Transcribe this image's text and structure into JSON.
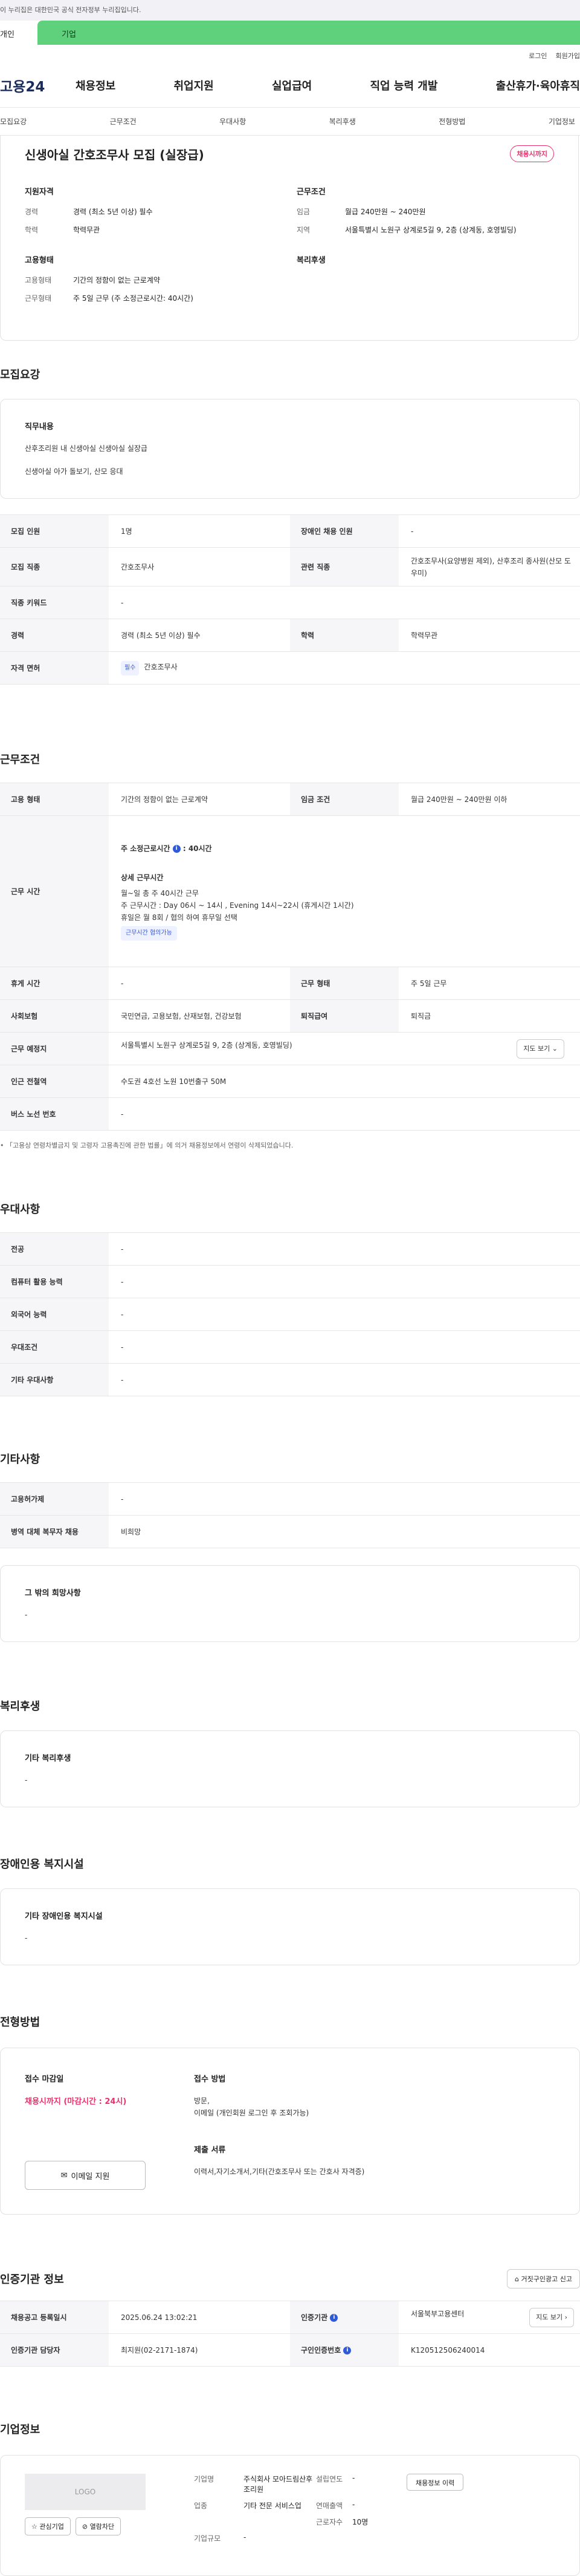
{
  "gov_bar": {
    "text": "이 누리집은 대한민국 공식 전자정부 누리집입니다."
  },
  "tabs": {
    "person": "개인",
    "company": "기업"
  },
  "util": {
    "login": "로그인",
    "signup": "회원가입"
  },
  "gnb": {
    "logo": "고용24",
    "items": [
      "채용정보",
      "취업지원",
      "실업급여",
      "직업 능력 개발",
      "출산휴가·육아휴직"
    ]
  },
  "anchor_nav": [
    "모집요강",
    "근무조건",
    "우대사항",
    "복리후생",
    "전형방법",
    "기업정보"
  ],
  "summary": {
    "title": "신생아실 간호조무사 모집 (실장급)",
    "badge": "채용시까지",
    "qual_heading": "지원자격",
    "qual_rows": [
      {
        "k": "경력",
        "v": "경력 (최소 5년 이상) 필수"
      },
      {
        "k": "학력",
        "v": "학력무관"
      }
    ],
    "cond_heading": "근무조건",
    "cond_rows": [
      {
        "k": "임금",
        "v": "월급 240만원 ~ 240만원"
      },
      {
        "k": "지역",
        "v": "서울특별시 노원구 상계로5길 9, 2층 (상계동, 호영빌딩)"
      }
    ],
    "emp_heading": "고용형태",
    "emp_rows": [
      {
        "k": "고용형태",
        "v": "기간의 정함이 없는 근로계약"
      },
      {
        "k": "근무형태",
        "v": "주 5일 근무 (주 소정근로시간: 40시간)"
      }
    ],
    "welfare_heading": "복리후생"
  },
  "recruit": {
    "heading": "모집요강",
    "duty_heading": "직무내용",
    "duty_lines": [
      "산후조리원 내 신생아실 신생아실 실장급",
      "신생아실 아가 돌보기, 산모 응대"
    ],
    "rows": [
      [
        "모집 인원",
        "1명",
        "장애인 채용 인원",
        "-"
      ],
      [
        "모집 직종",
        "간호조무사",
        "관련 직종",
        "간호조무사(요양병원 제외), 산후조리 종사원(산모 도우미)"
      ],
      [
        "직종 키워드",
        "-"
      ],
      [
        "경력",
        "경력 (최소 5년 이상) 필수",
        "학력",
        "학력무관"
      ]
    ],
    "license_key": "자격 면허",
    "license_chip": "필수",
    "license_value": "간호조무사"
  },
  "conditions": {
    "heading": "근무조건",
    "row1": [
      "고용 형태",
      "기간의 정함이 없는 근로계약",
      "임금 조건",
      "월급 240만원 ~ 240만원 이하"
    ],
    "time_key": "근무 시간",
    "time_week_label": "주 소정근로시간",
    "time_week_value": ": 40시간",
    "detail_title": "상세 근무시간",
    "detail_lines": [
      "월~일 총 주 40시간 근무",
      "주 근무시간 : Day 06시 ~ 14시 , Evening 14시~22시 (휴게시간 1시간)",
      "휴일은 월 8회 / 협의 하여 휴무일 선택"
    ],
    "time_chip": "근무시간 협의가능",
    "row3": [
      "휴게 시간",
      "-",
      "근무 형태",
      "주 5일 근무"
    ],
    "row4": [
      "사회보험",
      "국민연금, 고용보험, 산재보험, 건강보험",
      "퇴직급여",
      "퇴직금"
    ],
    "place_key": "근무 예정지",
    "place_value": "서울특별시 노원구 상계로5길 9, 2층 (상계동, 호영빌딩)",
    "map_btn": "지도 보기",
    "row6": [
      "인근 전철역",
      "수도권 4호선 노원 10번출구 50M"
    ],
    "row7": [
      "버스 노선 번호",
      "-"
    ],
    "notice": "「고용상 연령차별금지 및 고령자 고용촉진에 관한 법률」에 의거 채용정보에서 연령이 삭제되었습니다."
  },
  "preference": {
    "heading": "우대사항",
    "rows": [
      [
        "전공",
        "-"
      ],
      [
        "컴퓨터 활용 능력",
        "-"
      ],
      [
        "외국어 능력",
        "-"
      ],
      [
        "우대조건",
        "-"
      ],
      [
        "기타 우대사항",
        "-"
      ]
    ]
  },
  "etc": {
    "heading": "기타사항",
    "rows": [
      [
        "고용허가제",
        "-"
      ],
      [
        "병역 대체 복무자 채용",
        "비희망"
      ]
    ],
    "wish_heading": "그 밖의 희망사항",
    "wish_value": "-"
  },
  "welfare": {
    "heading": "복리후생",
    "card_heading": "기타 복리후생",
    "value": "-"
  },
  "disability": {
    "heading": "장애인용 복지시설",
    "card_heading": "기타 장애인용 복지시설",
    "value": "-"
  },
  "selection": {
    "heading": "전형방법",
    "deadline_heading": "접수 마감일",
    "deadline": "채용시까지 (마감시간 : 24시)",
    "email_btn": "이메일 지원",
    "method_heading": "접수 방법",
    "method_lines": [
      "방문,",
      "이메일 (개인회원 로그인 후 조회가능)"
    ],
    "docs_heading": "제출 서류",
    "docs_value": "이력서,자기소개서,기타(간호조무사 또는 간호사 자격증)"
  },
  "cert": {
    "heading": "인증기관 정보",
    "report_btn": "거짓구인광고 신고",
    "row1": [
      "채용공고 등록일시",
      "2025.06.24 13:02:21",
      "인증기관",
      "서울북부고용센터"
    ],
    "map_btn": "지도 보기",
    "row2": [
      "인증기관 담당자",
      "최지원(02-2171-1874)",
      "구인인증번호",
      "K120512506240014"
    ]
  },
  "company": {
    "heading": "기업정보",
    "logo_placeholder": "LOGO",
    "fav_btn": "관심기업",
    "block_btn": "열람차단",
    "name_k": "기업명",
    "name_v": "주식회사 모아드림산후조리원",
    "founded_k": "설립연도",
    "founded_v": "-",
    "ceo_btn": "채용정보 이력",
    "industry_k": "업종",
    "industry_v": "기타 전문 서비스업",
    "sales_k": "연매출액",
    "sales_v": "-",
    "emp_k": "근로자수",
    "emp_v": "10명",
    "size_k": "기업규모",
    "size_v": "-"
  }
}
